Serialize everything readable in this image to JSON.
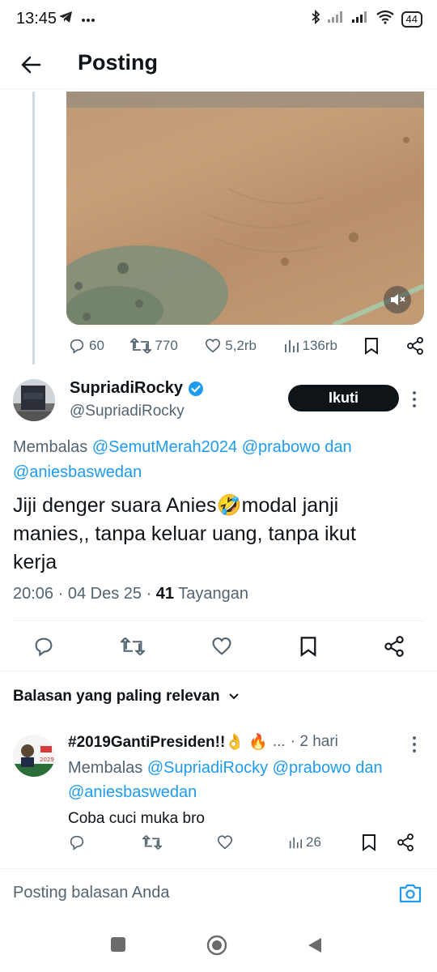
{
  "status_bar": {
    "time": "13:45",
    "battery": "44",
    "icons": [
      "telegram-icon",
      "more-icon",
      "bluetooth-icon",
      "signal-icon",
      "signal-icon",
      "wifi-icon",
      "battery-icon"
    ]
  },
  "header": {
    "title": "Posting"
  },
  "parent_tweet": {
    "actions": {
      "replies": "60",
      "reposts": "770",
      "likes": "5,2rb",
      "views": "136rb"
    }
  },
  "main_tweet": {
    "author_name": "SupriadiRocky",
    "author_handle": "@SupriadiRocky",
    "follow_label": "Ikuti",
    "replying_prefix": "Membalas",
    "mention_1": "@SemutMerah2024",
    "mention_2": "@prabowo",
    "connector": "dan",
    "mention_3": "@aniesbaswedan",
    "text_line_1": "Jiji denger suara Anies🤣modal janji",
    "text_line_2": "manies,, tanpa keluar uang, tanpa ikut",
    "text_line_3": "kerja",
    "time": "20:06",
    "date": "04 Des 25",
    "views_count": "41",
    "views_label": "Tayangan"
  },
  "relevance_label": "Balasan yang paling relevan",
  "reply": {
    "author_name": "#2019GantiPresiden!!👌 🔥",
    "ellipsis": "...",
    "time": "· 2 hari",
    "replying_prefix": "Membalas",
    "mention_1": "@SupriadiRocky",
    "mention_2": "@prabowo",
    "connector": "dan",
    "mention_3": "@aniesbaswedan",
    "text": "Coba cuci muka bro",
    "views": "26"
  },
  "compose": {
    "placeholder": "Posting balasan Anda"
  },
  "colors": {
    "accent": "#1d9bf0",
    "text": "#0f1419",
    "muted": "#536471",
    "border": "#eff3f4"
  }
}
